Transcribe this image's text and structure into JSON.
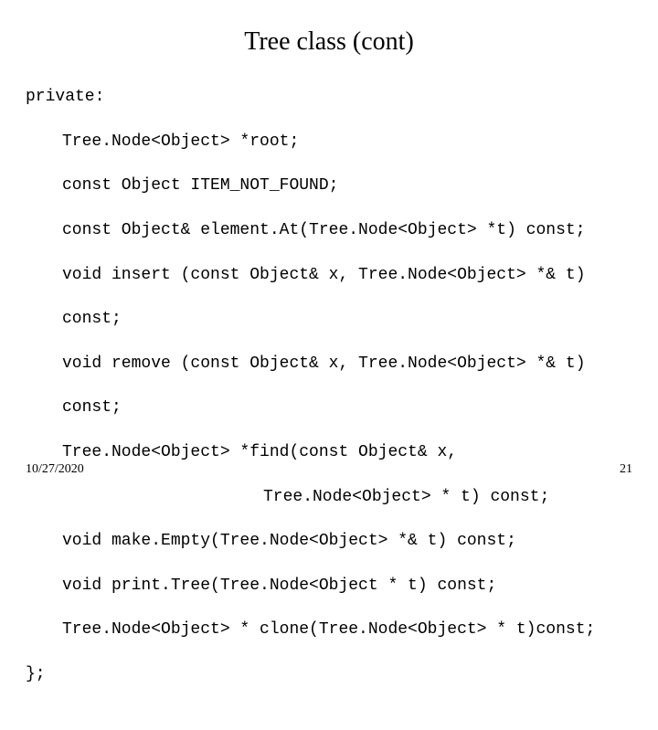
{
  "title": "Tree class (cont)",
  "code": {
    "l0": "private:",
    "l1": "Tree.Node<Object> *root;",
    "l2": "const Object ITEM_NOT_FOUND;",
    "l3": "const Object& element.At(Tree.Node<Object> *t) const;",
    "l4": "void insert (const Object& x, Tree.Node<Object> *& t)",
    "l5": "const;",
    "l6": "void remove (const Object& x, Tree.Node<Object> *& t)",
    "l7": "const;",
    "l8": "Tree.Node<Object> *find(const Object& x,",
    "l9": "Tree.Node<Object> * t) const;",
    "l10": "void make.Empty(Tree.Node<Object> *& t) const;",
    "l11": "void print.Tree(Tree.Node<Object * t) const;",
    "l12": "Tree.Node<Object> * clone(Tree.Node<Object> * t)const;",
    "l13": "};"
  },
  "footer": {
    "date": "10/27/2020",
    "page": "21"
  }
}
